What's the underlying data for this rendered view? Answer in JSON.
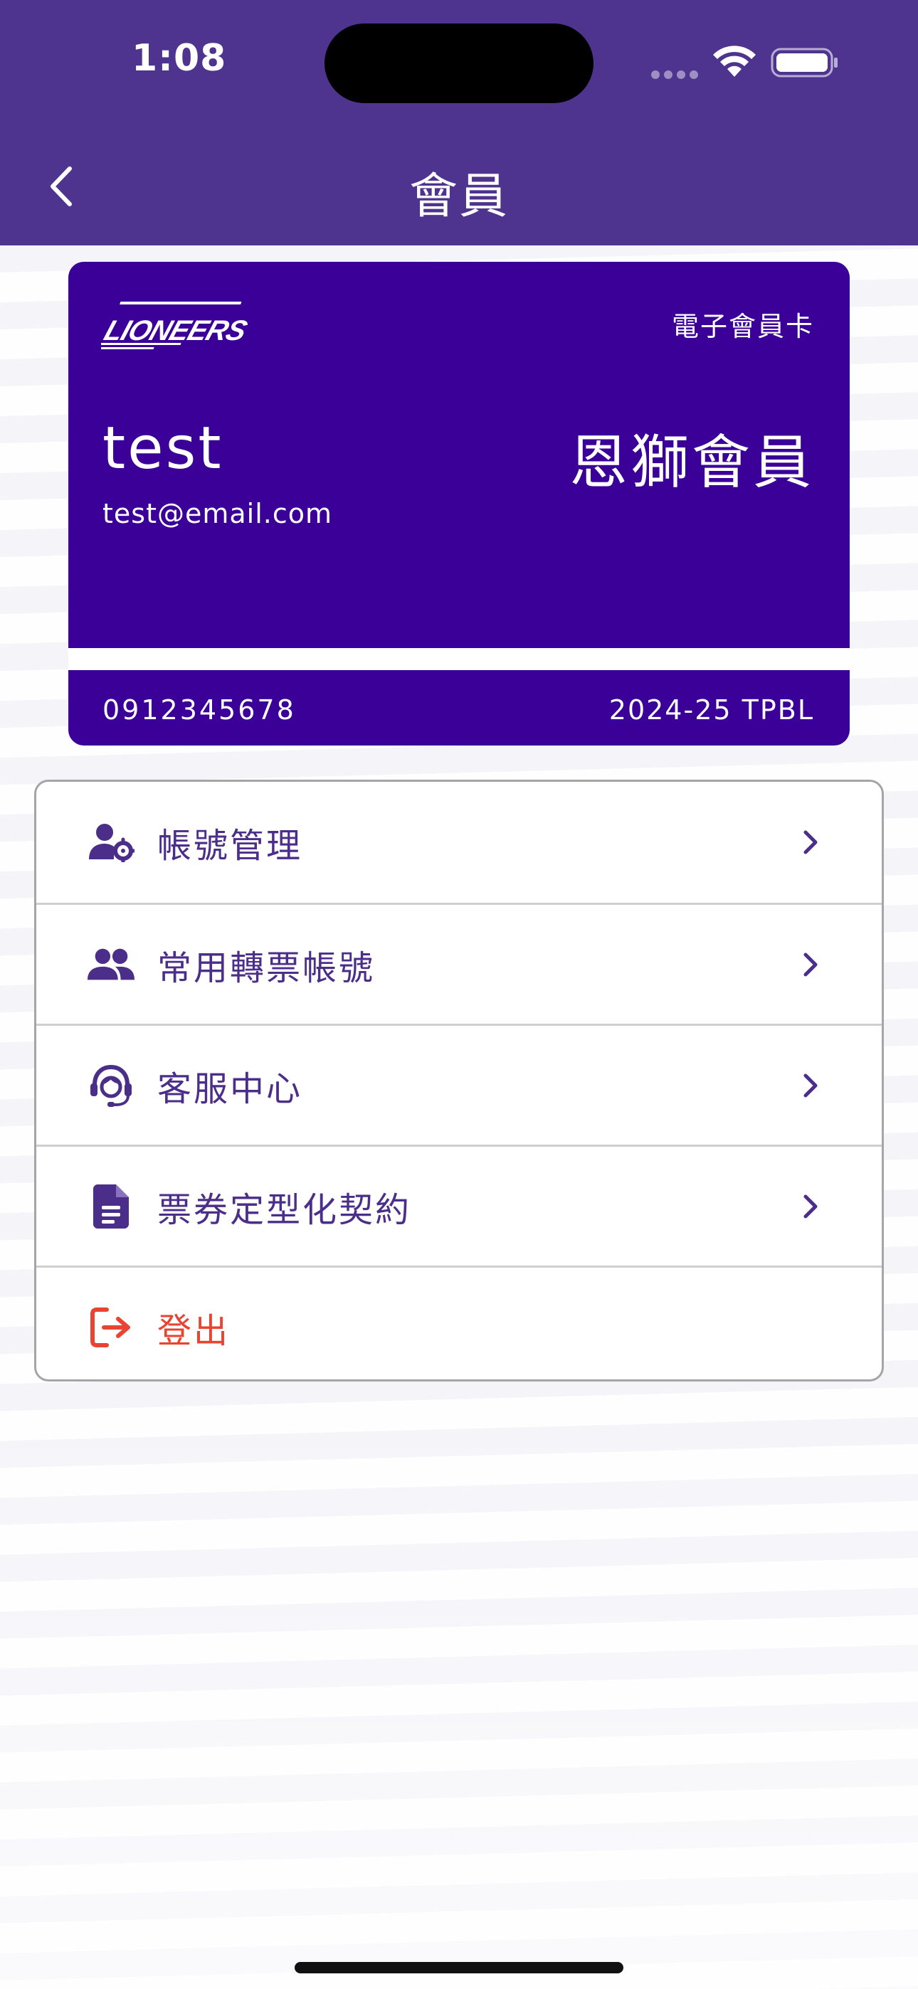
{
  "status_bar": {
    "time": "1:08"
  },
  "header": {
    "title": "會員"
  },
  "member_card": {
    "logo_text": "LIONEERS",
    "card_type": "電子會員卡",
    "name": "test",
    "level": "恩獅會員",
    "email": "test@email.com",
    "phone": "0912345678",
    "season": "2024-25 TPBL"
  },
  "menu": {
    "items": [
      {
        "label": "帳號管理",
        "icon": "user-gear-icon"
      },
      {
        "label": "常用轉票帳號",
        "icon": "users-icon"
      },
      {
        "label": "客服中心",
        "icon": "headset-icon"
      },
      {
        "label": "票券定型化契約",
        "icon": "document-icon"
      },
      {
        "label": "登出",
        "icon": "logout-icon"
      }
    ]
  },
  "colors": {
    "header_bg": "#4e338f",
    "card_bg": "#3a0098",
    "menu_text": "#4b2d8a",
    "logout_text": "#e84431"
  }
}
